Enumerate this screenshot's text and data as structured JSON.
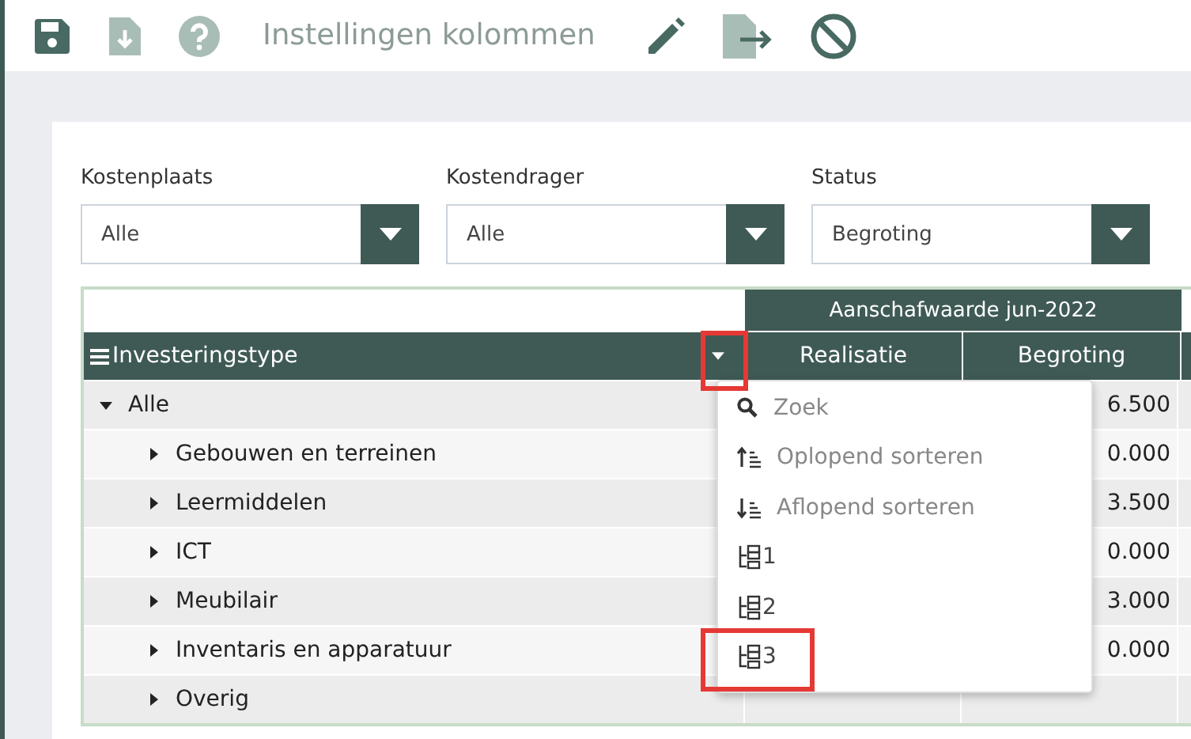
{
  "toolbar": {
    "title": "Instellingen kolommen",
    "tools": [
      {
        "kind": "save",
        "disabled": false
      },
      {
        "kind": "download",
        "disabled": true
      },
      {
        "kind": "help",
        "disabled": true
      },
      {
        "kind": "title"
      },
      {
        "kind": "edit",
        "disabled": false
      },
      {
        "kind": "export",
        "disabled": false
      },
      {
        "kind": "cancel",
        "disabled": false
      }
    ]
  },
  "filters": [
    {
      "label": "Kostenplaats",
      "value": "Alle"
    },
    {
      "label": "Kostendrager",
      "value": "Alle"
    },
    {
      "label": "Status",
      "value": "Begroting"
    }
  ],
  "grid": {
    "group_header": "Aanschafwaarde jun-2022",
    "row_header": "Investeringstype",
    "filter_annotated": true,
    "columns": [
      "Realisatie",
      "Begroting"
    ],
    "rows": [
      {
        "label": "Alle",
        "expanded": true,
        "value": "6.500",
        "children": [
          {
            "label": "Gebouwen en terreinen",
            "expanded": false,
            "value": "0.000"
          },
          {
            "label": "Leermiddelen",
            "expanded": false,
            "value": "3.500"
          },
          {
            "label": "ICT",
            "expanded": false,
            "value": "0.000"
          },
          {
            "label": "Meubilair",
            "expanded": false,
            "value": "3.000"
          },
          {
            "label": "Inventaris en apparatuur",
            "expanded": false,
            "value": "0.000"
          },
          {
            "label": "Overig",
            "expanded": false
          }
        ]
      }
    ]
  },
  "menu": {
    "items": [
      {
        "kind": "search",
        "label": "Zoek",
        "annotated": false
      },
      {
        "kind": "sort-asc",
        "label": "Oplopend sorteren",
        "annotated": false
      },
      {
        "kind": "sort-desc",
        "label": "Aflopend sorteren",
        "annotated": false
      },
      {
        "kind": "level",
        "label": "1",
        "annotated": false
      },
      {
        "kind": "level",
        "label": "2",
        "annotated": false
      },
      {
        "kind": "level",
        "label": "3",
        "annotated": true
      }
    ]
  }
}
